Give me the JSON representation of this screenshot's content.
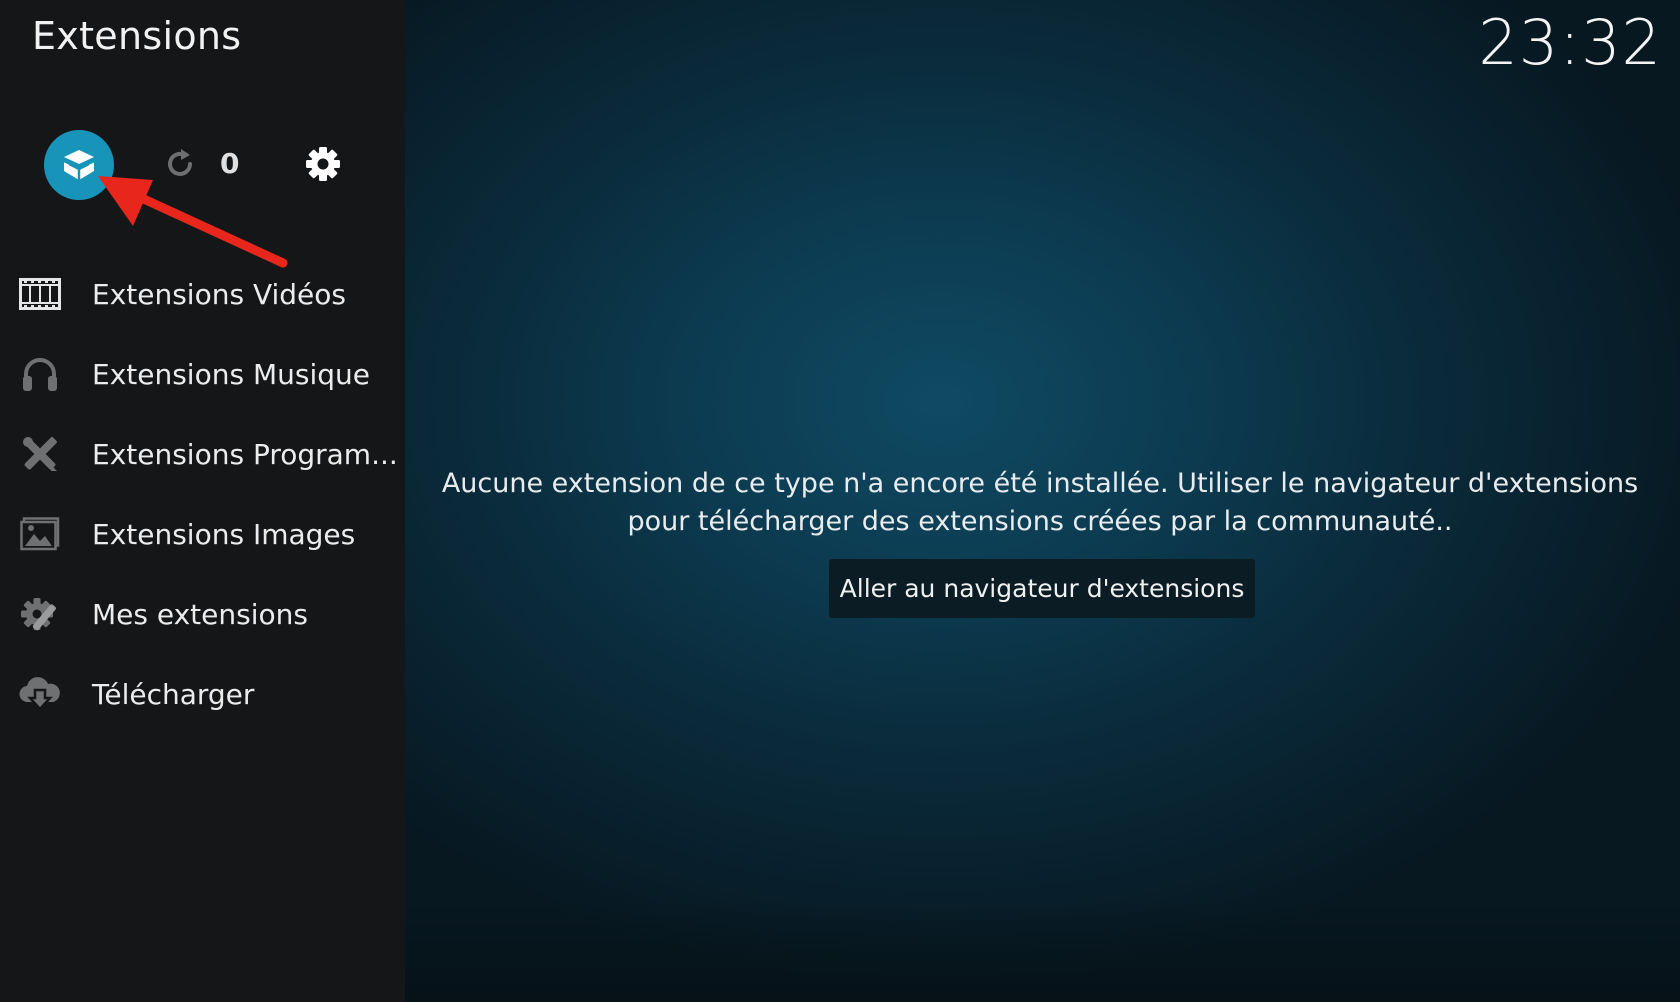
{
  "header": {
    "title": "Extensions",
    "clock": "23:32"
  },
  "toolbar": {
    "browser_icon": "open-box-icon",
    "update_icon": "refresh-icon",
    "update_count": "0",
    "settings_icon": "gear-icon",
    "accent_color": "#1893b9"
  },
  "sidebar": {
    "items": [
      {
        "label": "Extensions Vidéos",
        "icon": "film-icon"
      },
      {
        "label": "Extensions Musique",
        "icon": "headphones-icon"
      },
      {
        "label": "Extensions Program...",
        "icon": "tools-icon"
      },
      {
        "label": "Extensions Images",
        "icon": "picture-icon"
      },
      {
        "label": "Mes extensions",
        "icon": "gear-puzzle-icon"
      },
      {
        "label": "Télécharger",
        "icon": "cloud-download-icon"
      }
    ]
  },
  "main": {
    "message": "Aucune extension de ce type n'a encore été installée. Utiliser le navigateur d'extensions pour télécharger des extensions créées par la communauté..",
    "browse_button": "Aller au navigateur d'extensions"
  },
  "annotation": {
    "arrow_color": "#e8261c"
  }
}
